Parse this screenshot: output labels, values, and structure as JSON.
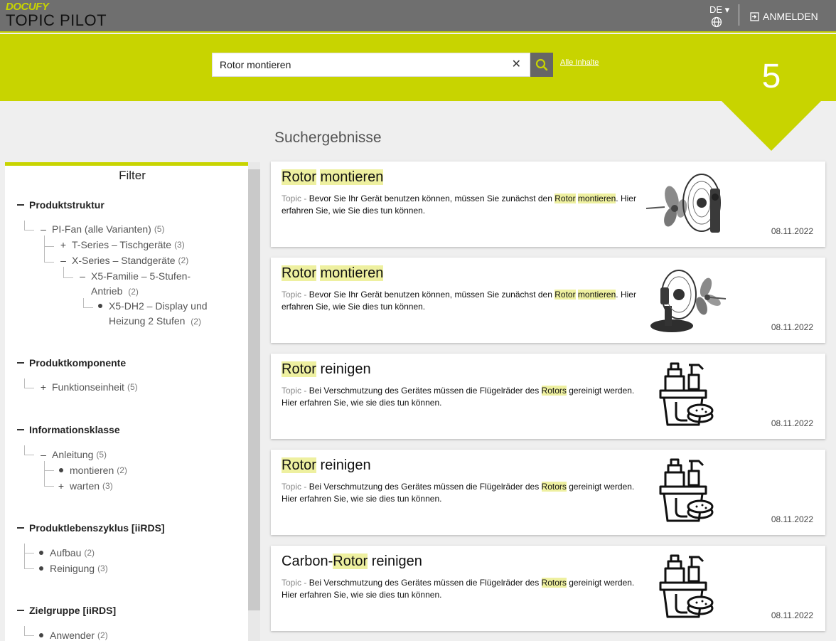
{
  "header": {
    "logo_top": "DOCUFY",
    "logo_bottom": "TOPIC PILOT",
    "language": "DE",
    "login_label": "ANMELDEN"
  },
  "search": {
    "value": "Rotor montieren",
    "all_content_link": "Alle Inhalte",
    "result_count": "5"
  },
  "results_title": "Suchergebnisse",
  "filter": {
    "title": "Filter",
    "groups": [
      {
        "title": "Produktstruktur",
        "nodes": [
          {
            "label": "PI-Fan (alle Varianten)",
            "count": "(5)"
          },
          {
            "label": "T-Series – Tischgeräte",
            "count": "(3)"
          },
          {
            "label": "X-Series – Standgeräte",
            "count": "(2)"
          },
          {
            "label": "X5-Familie – 5-Stufen-",
            "label2": "Antrieb",
            "count": "(2)"
          },
          {
            "label": "X5-DH2 – Display und",
            "label2": "Heizung 2 Stufen",
            "count": "(2)"
          }
        ]
      },
      {
        "title": "Produktkomponente",
        "nodes": [
          {
            "label": "Funktionseinheit",
            "count": "(5)"
          }
        ]
      },
      {
        "title": "Informationsklasse",
        "nodes": [
          {
            "label": "Anleitung",
            "count": "(5)"
          },
          {
            "label": "montieren",
            "count": "(2)"
          },
          {
            "label": "warten",
            "count": "(3)"
          }
        ]
      },
      {
        "title": "Produktlebenszyklus [iiRDS]",
        "nodes": [
          {
            "label": "Aufbau",
            "count": "(2)"
          },
          {
            "label": "Reinigung",
            "count": "(3)"
          }
        ]
      },
      {
        "title": "Zielgruppe [iiRDS]",
        "nodes": [
          {
            "label": "Anwender",
            "count": "(2)"
          }
        ]
      }
    ]
  },
  "results": [
    {
      "title_parts": [
        "Rotor",
        " ",
        "montieren"
      ],
      "type": "Topic",
      "sep": " - ",
      "desc_parts": [
        "Bevor Sie Ihr Gerät benutzen können, müssen Sie zunächst den ",
        "Rotor",
        " ",
        "montieren",
        ". Hier erfahren Sie, wie Sie dies tun können."
      ],
      "date": "08.11.2022",
      "image": "wall-fan-icon"
    },
    {
      "title_parts": [
        "Rotor",
        " ",
        "montieren"
      ],
      "type": "Topic",
      "sep": " - ",
      "desc_parts": [
        "Bevor Sie Ihr Gerät benutzen können, müssen Sie zunächst den ",
        "Rotor",
        " ",
        "montieren",
        ". Hier erfahren Sie, wie Sie dies tun können."
      ],
      "date": "08.11.2022",
      "image": "desk-fan-icon"
    },
    {
      "title_parts": [
        "",
        "Rotor",
        " reinigen"
      ],
      "type": "Topic",
      "sep": " - ",
      "desc_parts": [
        "Bei Verschmutzung des Gerätes müssen die Flügelräder des ",
        "Rotors",
        " gereinigt werden. Hier erfahren Sie, wie sie dies tun können."
      ],
      "date": "08.11.2022",
      "image": "cleaning-icon"
    },
    {
      "title_parts": [
        "",
        "Rotor",
        " reinigen"
      ],
      "type": "Topic",
      "sep": " - ",
      "desc_parts": [
        "Bei Verschmutzung des Gerätes müssen die Flügelräder des ",
        "Rotors",
        " gereinigt werden. Hier erfahren Sie, wie sie dies tun können."
      ],
      "date": "08.11.2022",
      "image": "cleaning-icon"
    },
    {
      "title_parts": [
        "Carbon-",
        "Rotor",
        " reinigen"
      ],
      "type": "Topic",
      "sep": " - ",
      "desc_parts": [
        "Bei Verschmutzung des Gerätes müssen die Flügelräder des ",
        "Rotors",
        " gereinigt werden. Hier erfahren Sie, wie sie dies tun können."
      ],
      "date": "08.11.2022",
      "image": "cleaning-icon"
    }
  ],
  "colors": {
    "accent": "#c8d400",
    "header_bg": "#6f6f6f",
    "highlight": "#eef0a0"
  }
}
